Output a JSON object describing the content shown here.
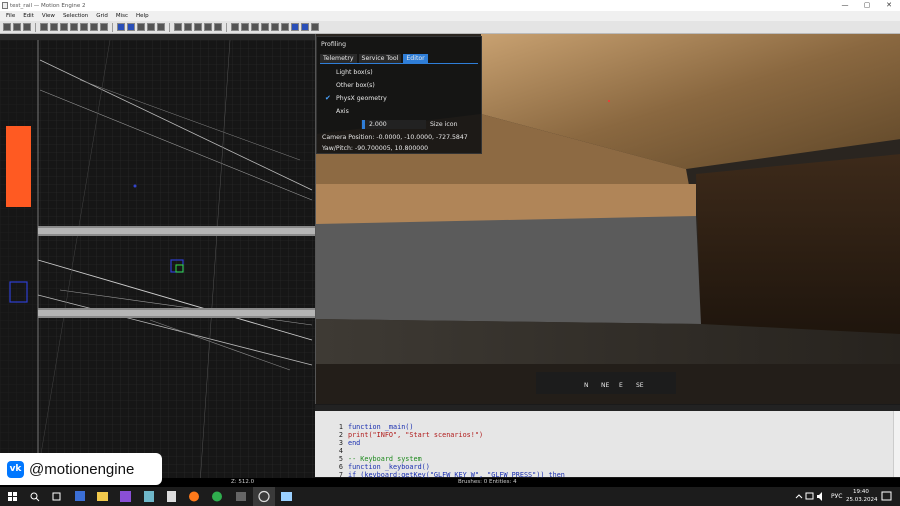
{
  "window": {
    "title": "test_rail — Motion Engine 2",
    "minimize": "—",
    "maximize": "▢",
    "close": "✕"
  },
  "menu": [
    "File",
    "Edit",
    "View",
    "Selection",
    "Grid",
    "Misc",
    "Help"
  ],
  "profiling": {
    "title": "Profiling",
    "tabs": [
      "Telemetry",
      "Service Tool",
      "Editor"
    ],
    "active_tab": "Editor",
    "options": [
      {
        "label": "Light box(s)",
        "checked": false
      },
      {
        "label": "Other box(s)",
        "checked": false
      },
      {
        "label": "PhysX geometry",
        "checked": true
      },
      {
        "label": "Axis",
        "checked": false
      }
    ],
    "size_value": "2.000",
    "size_label": "Size icon",
    "camera_position": "Camera Position: -0.0000, -10.0000, -727.5847",
    "yaw_pitch": "Yaw/Pitch: -90.700005, 10.800000"
  },
  "compass": [
    "N",
    "NE",
    "E",
    "SE"
  ],
  "code": [
    {
      "n": "1",
      "text": "function _main()",
      "color": "#1a2fb0"
    },
    {
      "n": "2",
      "text": "print(\"INFO\", \"Start scenarios!\")",
      "color": "#b01a1a"
    },
    {
      "n": "3",
      "text": "end",
      "color": "#1a2fb0"
    },
    {
      "n": "4",
      "text": "",
      "color": "#111111"
    },
    {
      "n": "5",
      "text": "-- Keyboard system",
      "color": "#1e8a1e"
    },
    {
      "n": "6",
      "text": "function _keyboard()",
      "color": "#1a2fb0"
    },
    {
      "n": "7",
      "text": "if (keyboard:getKey(\"GLFW_KEY_W\", \"GLFW_PRESS\")) then",
      "color": "#1a2fb0"
    }
  ],
  "status": {
    "z": "Z: 512.0",
    "counts": "Brushes: 0 Entities: 4"
  },
  "badge": {
    "vk": "vk",
    "handle": "@motionengine"
  },
  "tray": {
    "lang": "РУС",
    "time": "19:40",
    "date": "25.03.2024"
  }
}
